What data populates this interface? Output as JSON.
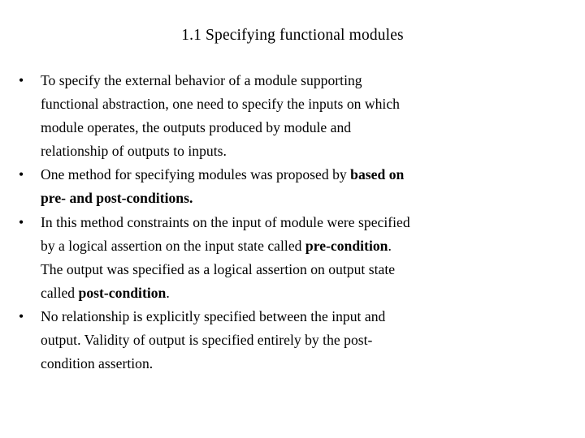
{
  "slide": {
    "title": "1.1 Specifying functional modules",
    "bullet_marker": "•",
    "text_color": "#000000",
    "background_color": "#ffffff",
    "bullets": [
      {
        "id": "bullet-1",
        "full_text": "To specify the external behavior of a module supporting functional abstraction, one need to specify the inputs on which module operates, the outputs produced by module and relationship of outputs to inputs.",
        "lines": [
          {
            "text": "To specify the external behavior of a module supporting",
            "last": false
          },
          {
            "text": "functional abstraction, one need to specify the inputs on which",
            "last": false
          },
          {
            "text": "module operates, the outputs produced by module and",
            "last": false
          },
          {
            "text": "relationship of outputs to inputs.",
            "last": true
          }
        ]
      },
      {
        "id": "bullet-2",
        "full_text": "One method for specifying modules was proposed by based on pre- and post-conditions.",
        "lines": [
          {
            "text_plain": "One method for specifying modules was proposed by based on",
            "last": false,
            "runs": [
              {
                "text": "One method for specifying modules was proposed by ",
                "bold": false
              },
              {
                "text": "based on",
                "bold": true
              }
            ]
          },
          {
            "text_plain": "pre- and post-conditions.",
            "last": true,
            "runs": [
              {
                "text": "pre- and post-conditions.",
                "bold": true
              }
            ]
          }
        ]
      },
      {
        "id": "bullet-3",
        "full_text": "In this method constraints on the input of module were specified by a logical assertion on the input state called pre-condition. The output was specified as a logical assertion on output state called post-condition.",
        "lines": [
          {
            "text_plain": "In this method constraints on the input of module were specified",
            "last": false,
            "runs": [
              {
                "text": "In this method constraints on the input of module were specified",
                "bold": false
              }
            ]
          },
          {
            "text_plain": "by a logical assertion on the input state called pre-condition.",
            "last": false,
            "runs": [
              {
                "text": "by a logical assertion on the input state called ",
                "bold": false
              },
              {
                "text": "pre-condition",
                "bold": true
              },
              {
                "text": ".",
                "bold": false
              }
            ]
          },
          {
            "text_plain": "The output was specified as a logical assertion on output state",
            "last": false,
            "runs": [
              {
                "text": "The output was specified as a logical assertion on output state",
                "bold": false
              }
            ]
          },
          {
            "text_plain": "called post-condition.",
            "last": true,
            "runs": [
              {
                "text": "called ",
                "bold": false
              },
              {
                "text": "post-condition",
                "bold": true
              },
              {
                "text": ".",
                "bold": false
              }
            ]
          }
        ]
      },
      {
        "id": "bullet-4",
        "full_text": "No relationship is explicitly specified between the input and output. Validity of output is specified entirely by the post-condition assertion.",
        "lines": [
          {
            "text": "No relationship is explicitly specified between the input and",
            "last": false
          },
          {
            "text": "output. Validity of output is specified entirely by the post-",
            "last": false
          },
          {
            "text": "condition assertion.",
            "last": true
          }
        ]
      }
    ]
  }
}
